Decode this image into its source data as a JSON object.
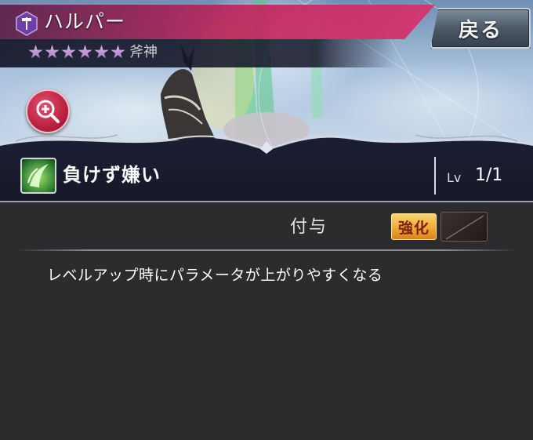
{
  "header": {
    "weapon_name": "ハルパー",
    "weapon_type": "斧神",
    "rarity_stars": 6,
    "back_label": "戻る",
    "weapon_icon": "axe-icon",
    "zoom_icon": "zoom-in-icon"
  },
  "skill": {
    "name": "負けず嫌い",
    "icon": "skill-claw-icon",
    "level_label": "Lv",
    "level_value": "1/1"
  },
  "ability": {
    "type_label": "付与",
    "enhance_label": "強化",
    "description": "レベルアップ時にパラメータが上がりやすくなる"
  },
  "colors": {
    "title_banner": "#c0265c",
    "panel_bg": "#2c2c2f",
    "skill_bar_bg": "#1b1d33",
    "enhance_badge": "#f0a531",
    "zoom_button": "#b51e3e"
  }
}
